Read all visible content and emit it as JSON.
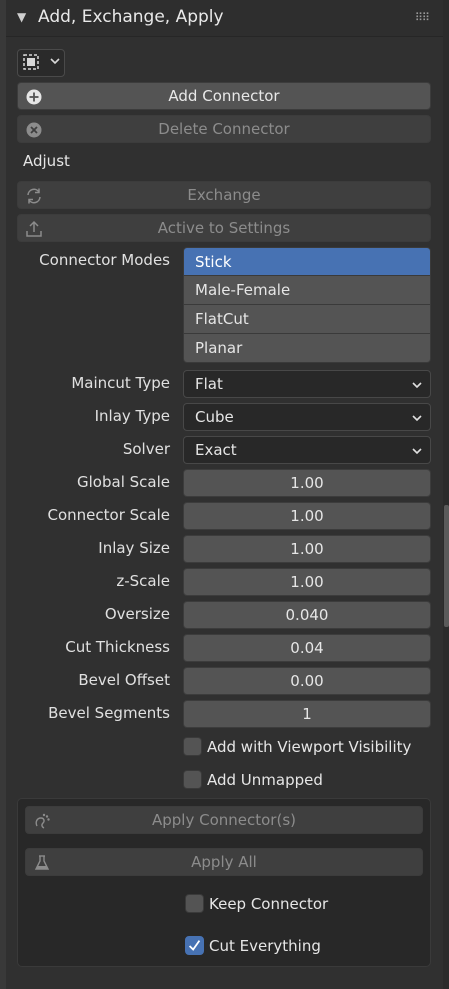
{
  "panel": {
    "title": "Add, Exchange, Apply",
    "collapse_icon": "triangle-down-icon",
    "grip_icon": "grip-dots-icon"
  },
  "selector": {
    "icon": "selection-box-icon",
    "chevron": "chevron-down-icon"
  },
  "buttons": {
    "add_connector": "Add Connector",
    "delete_connector": "Delete Connector",
    "exchange": "Exchange",
    "active_to_settings": "Active to Settings"
  },
  "adjust_label": "Adjust",
  "connector_modes": {
    "label": "Connector Modes",
    "options": [
      "Stick",
      "Male-Female",
      "FlatCut",
      "Planar"
    ],
    "selected": "Stick"
  },
  "dropdowns": {
    "maincut_type": {
      "label": "Maincut Type",
      "value": "Flat"
    },
    "inlay_type": {
      "label": "Inlay Type",
      "value": "Cube"
    },
    "solver": {
      "label": "Solver",
      "value": "Exact"
    }
  },
  "fields": {
    "global_scale": {
      "label": "Global Scale",
      "value": "1.00"
    },
    "connector_scale": {
      "label": "Connector Scale",
      "value": "1.00"
    },
    "inlay_size": {
      "label": "Inlay Size",
      "value": "1.00"
    },
    "z_scale": {
      "label": "z-Scale",
      "value": "1.00"
    },
    "oversize": {
      "label": "Oversize",
      "value": "0.040"
    },
    "cut_thickness": {
      "label": "Cut Thickness",
      "value": "0.04"
    },
    "bevel_offset": {
      "label": "Bevel Offset",
      "value": "0.00"
    },
    "bevel_segments": {
      "label": "Bevel Segments",
      "value": "1"
    }
  },
  "checkboxes": {
    "viewport_visibility": {
      "label": "Add with Viewport Visibility",
      "checked": false
    },
    "add_unmapped": {
      "label": "Add Unmapped",
      "checked": false
    },
    "keep_connector": {
      "label": "Keep Connector",
      "checked": false
    },
    "cut_everything": {
      "label": "Cut Everything",
      "checked": true
    }
  },
  "apply_box": {
    "apply_connectors": "Apply Connector(s)",
    "apply_all": "Apply All"
  },
  "colors": {
    "panel_bg": "#303030",
    "button": "#545454",
    "accent": "#4772b3",
    "text": "#e6e6e6",
    "disabled_text": "#8c8c8c"
  }
}
